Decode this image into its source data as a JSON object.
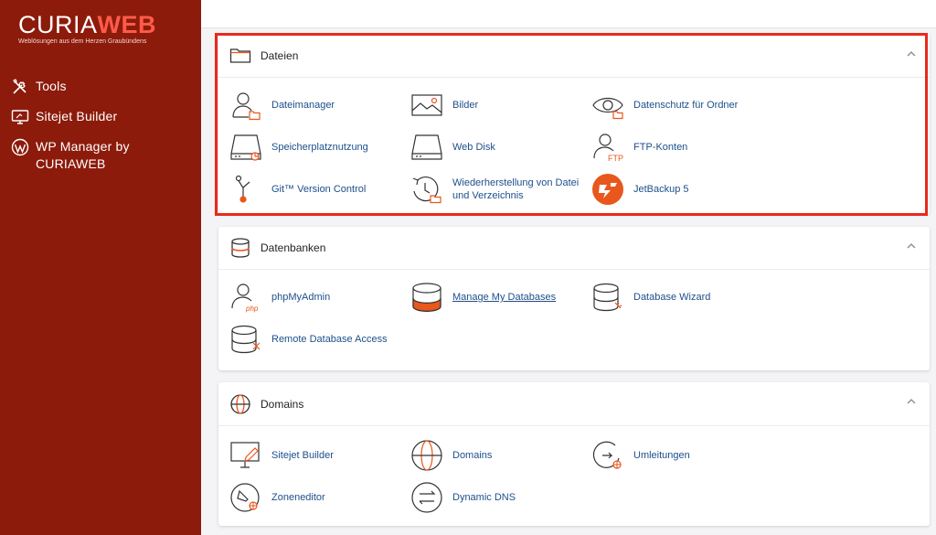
{
  "brand": {
    "name_part1": "CURIA",
    "name_part2": "WEB",
    "tagline": "Weblösungen aus dem Herzen Graubündens"
  },
  "sidebar": {
    "items": [
      {
        "label": "Tools",
        "icon": "tools-icon"
      },
      {
        "label": "Sitejet Builder",
        "icon": "sitejet-icon"
      },
      {
        "label": "WP Manager by CURIAWEB",
        "icon": "wordpress-icon"
      }
    ]
  },
  "sections": [
    {
      "title": "Dateien",
      "icon": "folder-icon",
      "items": [
        {
          "label": "Dateimanager",
          "icon": "file-manager-icon"
        },
        {
          "label": "Bilder",
          "icon": "images-icon"
        },
        {
          "label": "Datenschutz für Ordner",
          "icon": "directory-privacy-icon"
        },
        {
          "label": "Speicherplatznutzung",
          "icon": "disk-usage-icon"
        },
        {
          "label": "Web Disk",
          "icon": "web-disk-icon"
        },
        {
          "label": "FTP-Konten",
          "icon": "ftp-accounts-icon"
        },
        {
          "label": "Git™ Version Control",
          "icon": "git-icon"
        },
        {
          "label": "Wiederherstellung von Datei und Verzeichnis",
          "icon": "restore-icon"
        },
        {
          "label": "JetBackup 5",
          "icon": "jetbackup-icon"
        }
      ]
    },
    {
      "title": "Datenbanken",
      "icon": "database-icon",
      "items": [
        {
          "label": "phpMyAdmin",
          "icon": "phpmyadmin-icon"
        },
        {
          "label": "Manage My Databases",
          "icon": "manage-databases-icon"
        },
        {
          "label": "Database Wizard",
          "icon": "database-wizard-icon"
        },
        {
          "label": "Remote Database Access",
          "icon": "remote-database-icon"
        }
      ]
    },
    {
      "title": "Domains",
      "icon": "globe-icon",
      "items": [
        {
          "label": "Sitejet Builder",
          "icon": "sitejet-builder-icon"
        },
        {
          "label": "Domains",
          "icon": "domains-icon"
        },
        {
          "label": "Umleitungen",
          "icon": "redirects-icon"
        },
        {
          "label": "Zoneneditor",
          "icon": "zone-editor-icon"
        },
        {
          "label": "Dynamic DNS",
          "icon": "dynamic-dns-icon"
        }
      ]
    }
  ],
  "colors": {
    "sidebar_bg": "#8c1b0b",
    "accent_orange": "#e8571c",
    "link_blue": "#1d4f8a",
    "highlight_red": "#e8291c"
  }
}
